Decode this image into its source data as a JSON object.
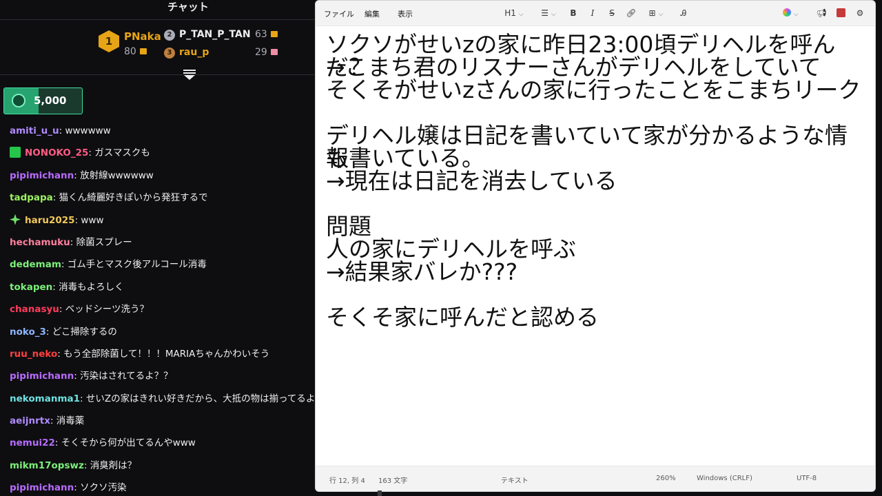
{
  "chat": {
    "title": "チャット",
    "leaderboard": {
      "first": {
        "rank": "1",
        "name": "PNaka",
        "points": "80"
      },
      "second": {
        "rank": "2",
        "name": "P_TAN_P_TAN",
        "points": "63"
      },
      "third": {
        "rank": "3",
        "name": "rau_p",
        "points": "29"
      }
    },
    "hype_train": {
      "count": "5,000",
      "progress_fraction": 0.44
    },
    "messages": [
      {
        "user": "amiti_u_u",
        "color": "#b08aff",
        "text": "wwwwww",
        "badge": ""
      },
      {
        "user": "NONOKO_25",
        "color": "#ff5c85",
        "text": "ガスマスクも",
        "badge": "gift-icon"
      },
      {
        "user": "pipimichann",
        "color": "#b86cff",
        "text": "放射線wwwwww",
        "badge": ""
      },
      {
        "user": "tadpapa",
        "color": "#9cf25f",
        "text": "猫くん綺麗好きぽいから発狂するで",
        "badge": ""
      },
      {
        "user": "haru2025",
        "color": "#f3c85b",
        "text": "www",
        "badge": "sparkle-icon"
      },
      {
        "user": "hechamuku",
        "color": "#ff7f9e",
        "text": "除菌スプレー",
        "badge": ""
      },
      {
        "user": "dedemam",
        "color": "#7cf07a",
        "text": "ゴム手とマスク後アルコール消毒",
        "badge": ""
      },
      {
        "user": "tokapen",
        "color": "#7cf07a",
        "text": "消毒もよろしく",
        "badge": ""
      },
      {
        "user": "chanasyu",
        "color": "#ff3b5c",
        "text": "ベッドシーツ洗う？",
        "badge": ""
      },
      {
        "user": "noko_3",
        "color": "#8fb7ff",
        "text": "どこ掃除するの",
        "badge": ""
      },
      {
        "user": "ruu_neko",
        "color": "#ff4040",
        "text": "もう全部除菌して！！！MARIAちゃんかわいそう",
        "badge": ""
      },
      {
        "user": "pipimichann",
        "color": "#b86cff",
        "text": "汚染はされてるよ？？",
        "badge": ""
      },
      {
        "user": "nekomanma1",
        "color": "#6fe0e0",
        "text": "せいZの家はきれい好きだから、大抵の物は揃ってるよ",
        "badge": ""
      },
      {
        "user": "aeijnrtx",
        "color": "#b08aff",
        "text": "消毒薬",
        "badge": ""
      },
      {
        "user": "nemui22",
        "color": "#b86cff",
        "text": "そくそから何が出てるんやwww",
        "badge": ""
      },
      {
        "user": "mikm17opswz",
        "color": "#7cf07a",
        "text": "消臭剤は？",
        "badge": ""
      },
      {
        "user": "pipimichann",
        "color": "#b86cff",
        "text": "ソクソ汚染",
        "badge": ""
      }
    ]
  },
  "notepad": {
    "menu": {
      "file": "ファイル",
      "edit": "編集",
      "view": "表示"
    },
    "toolbar": {
      "heading": "H1",
      "bold": "B",
      "italic": "I",
      "strike": "S"
    },
    "lines": [
      "ソクソがせいzの家に昨日23:00頃デリヘルを呼んだ？",
      "→こまち君のリスナーさんがデリヘルをしていて",
      "そくそがせいzさんの家に行ったことをこまちリーク",
      "",
      "デリヘル嬢は日記を書いていて家が分かるような情報",
      "も書いている。",
      "→現在は日記を消去している",
      "",
      "問題",
      "人の家にデリヘルを呼ぶ",
      "→結果家バレか???",
      "",
      "そくそ家に呼んだと認める"
    ],
    "status": {
      "position": "行 12, 列 4",
      "char_count": "163 文字",
      "format": "テキスト",
      "zoom": "260%",
      "line_ending": "Windows (CRLF)",
      "encoding": "UTF-8"
    }
  }
}
